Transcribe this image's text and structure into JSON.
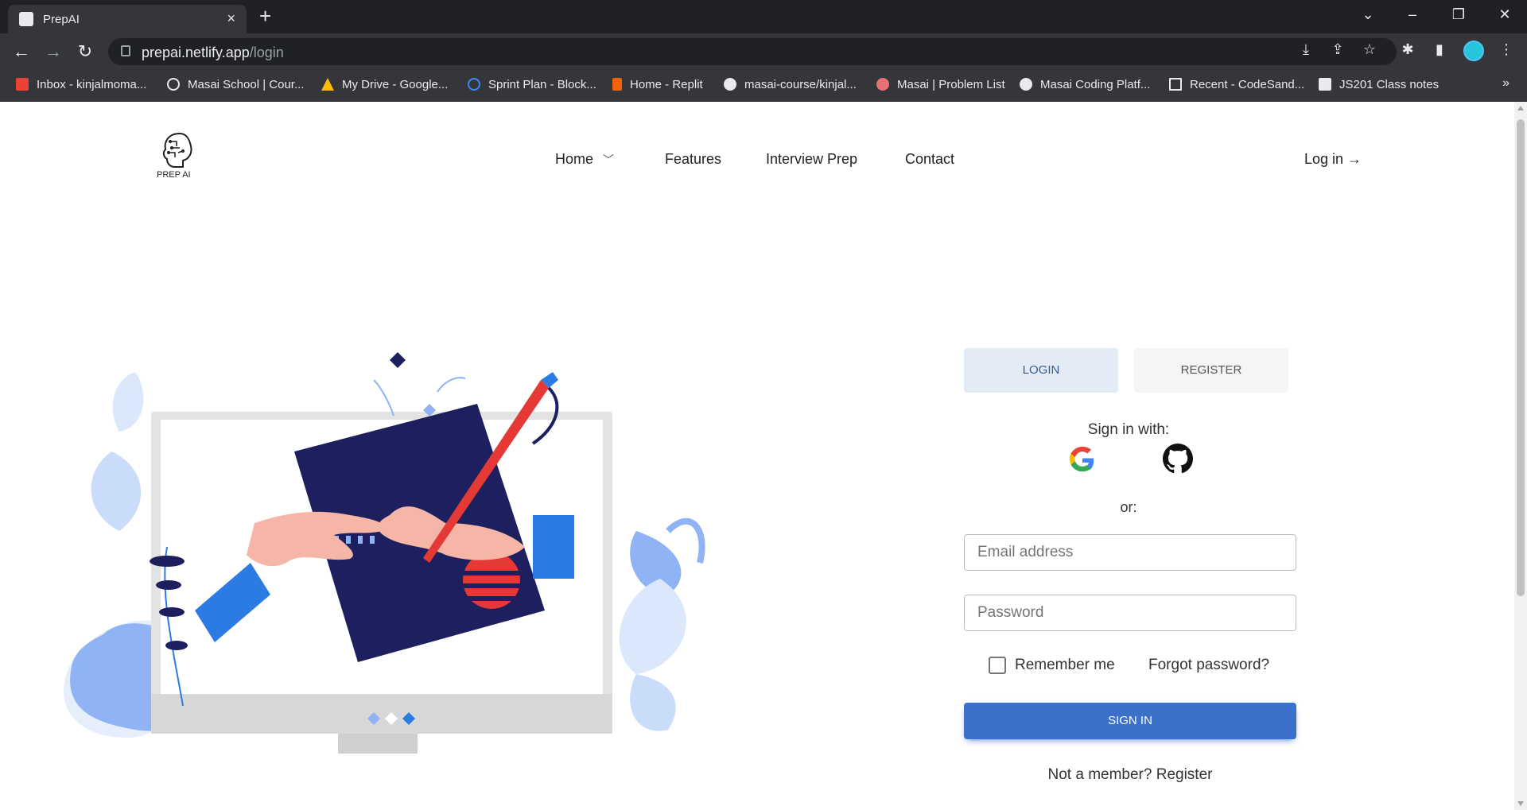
{
  "browser": {
    "tab_title": "PrepAI",
    "tab_close": "×",
    "new_tab": "+",
    "url_host": "prepai.netlify.app",
    "url_path": "/login",
    "bookmarks": [
      {
        "label": "Inbox - kinjalmoma...",
        "icon": "gmail-icon",
        "color": "#ea4335"
      },
      {
        "label": "Masai School | Cour...",
        "icon": "masai-icon",
        "color": "#e8eaed"
      },
      {
        "label": "My Drive - Google...",
        "icon": "google-drive-icon",
        "color": "#fbbc04"
      },
      {
        "label": "Sprint Plan - Block...",
        "icon": "sprint-icon",
        "color": "#4285f4"
      },
      {
        "label": "Home - Replit",
        "icon": "replit-icon",
        "color": "#f26207"
      },
      {
        "label": "masai-course/kinjal...",
        "icon": "github-icon",
        "color": "#e8eaed"
      },
      {
        "label": "Masai | Problem List",
        "icon": "masai-problem-icon",
        "color": "#e57373"
      },
      {
        "label": "Masai Coding Platf...",
        "icon": "masai-m-icon",
        "color": "#e8eaed"
      },
      {
        "label": "Recent - CodeSand...",
        "icon": "codesandbox-icon",
        "color": "#e8eaed"
      },
      {
        "label": "JS201 Class notes",
        "icon": "notion-icon",
        "color": "#e8eaed"
      }
    ],
    "bookmarks_more": "»"
  },
  "header": {
    "logo_text": "PREP AI",
    "nav": [
      "Home",
      "Features",
      "Interview Prep",
      "Contact"
    ],
    "login_link": "Log in →"
  },
  "form": {
    "tab_login": "LOGIN",
    "tab_register": "REGISTER",
    "sign_in_with": "Sign in with:",
    "or": "or:",
    "email_placeholder": "Email address",
    "password_placeholder": "Password",
    "remember_me": "Remember me",
    "forgot_password": "Forgot password?",
    "sign_in_button": "SIGN IN",
    "not_member": "Not a member? Register"
  },
  "colors": {
    "primary": "#3b71ca",
    "illustration_navy": "#1d1f5e",
    "illustration_blue": "#2c7be5",
    "illustration_red": "#e53935"
  }
}
